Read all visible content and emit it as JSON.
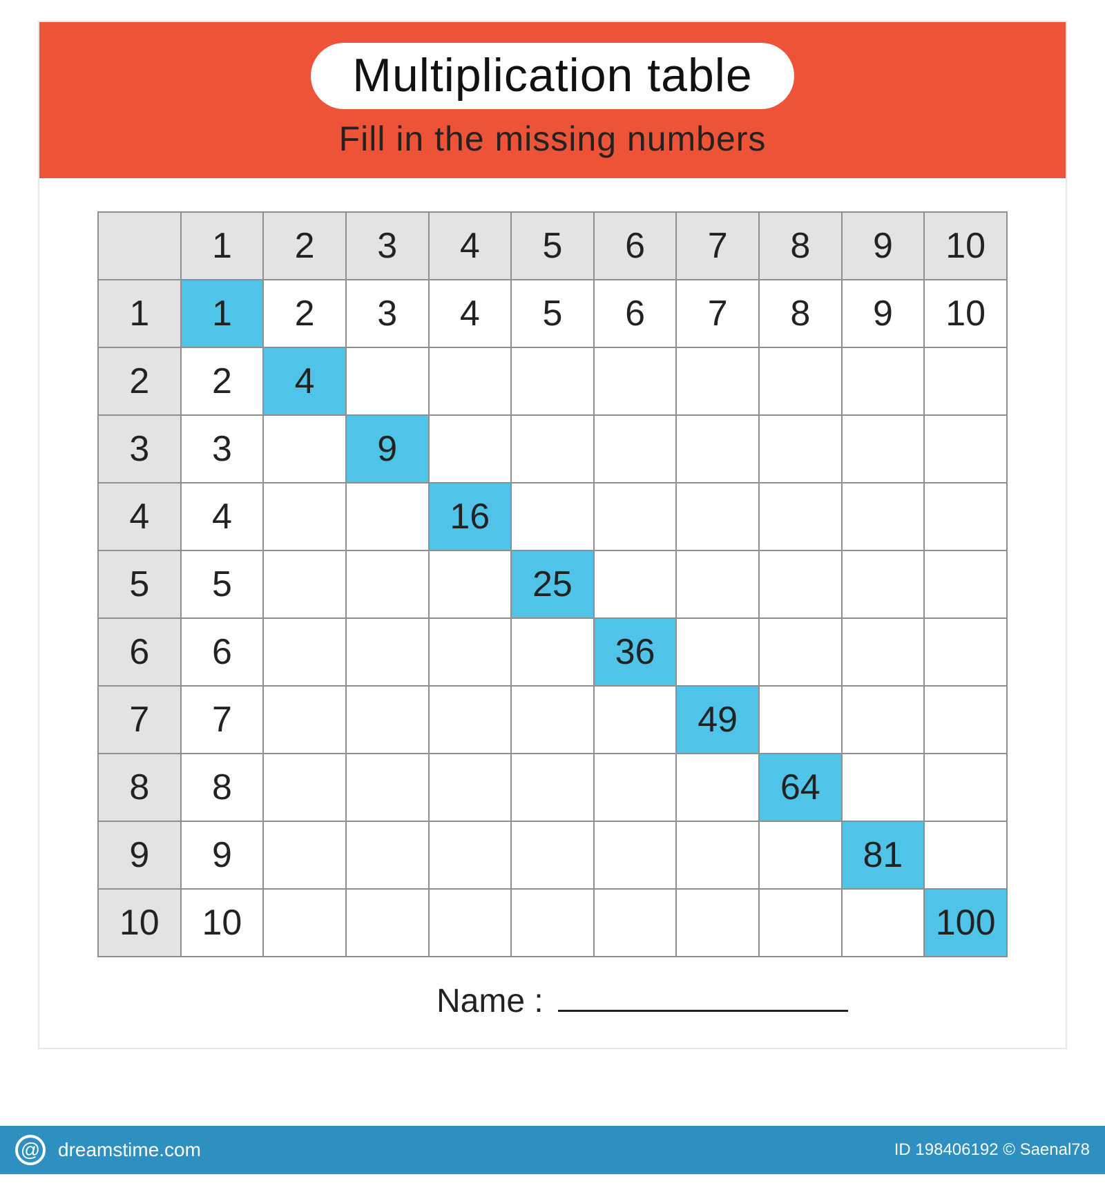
{
  "header": {
    "title": "Multiplication table",
    "subtitle": "Fill in the missing numbers"
  },
  "table": {
    "col_headers": [
      "1",
      "2",
      "3",
      "4",
      "5",
      "6",
      "7",
      "8",
      "9",
      "10"
    ],
    "rows": [
      {
        "header": "1",
        "cells": [
          "1",
          "2",
          "3",
          "4",
          "5",
          "6",
          "7",
          "8",
          "9",
          "10"
        ],
        "highlight_col": 0
      },
      {
        "header": "2",
        "cells": [
          "2",
          "4",
          "",
          "",
          "",
          "",
          "",
          "",
          "",
          ""
        ],
        "highlight_col": 1
      },
      {
        "header": "3",
        "cells": [
          "3",
          "",
          "9",
          "",
          "",
          "",
          "",
          "",
          "",
          ""
        ],
        "highlight_col": 2
      },
      {
        "header": "4",
        "cells": [
          "4",
          "",
          "",
          "16",
          "",
          "",
          "",
          "",
          "",
          ""
        ],
        "highlight_col": 3
      },
      {
        "header": "5",
        "cells": [
          "5",
          "",
          "",
          "",
          "25",
          "",
          "",
          "",
          "",
          ""
        ],
        "highlight_col": 4
      },
      {
        "header": "6",
        "cells": [
          "6",
          "",
          "",
          "",
          "",
          "36",
          "",
          "",
          "",
          ""
        ],
        "highlight_col": 5
      },
      {
        "header": "7",
        "cells": [
          "7",
          "",
          "",
          "",
          "",
          "",
          "49",
          "",
          "",
          ""
        ],
        "highlight_col": 6
      },
      {
        "header": "8",
        "cells": [
          "8",
          "",
          "",
          "",
          "",
          "",
          "",
          "64",
          "",
          ""
        ],
        "highlight_col": 7
      },
      {
        "header": "9",
        "cells": [
          "9",
          "",
          "",
          "",
          "",
          "",
          "",
          "",
          "81",
          ""
        ],
        "highlight_col": 8
      },
      {
        "header": "10",
        "cells": [
          "10",
          "",
          "",
          "",
          "",
          "",
          "",
          "",
          "",
          "100"
        ],
        "highlight_col": 9
      }
    ]
  },
  "name_label": "Name :",
  "footer": {
    "site": "dreamstime.com",
    "id_label": "ID 198406192 © Saenal78"
  },
  "colors": {
    "accent": "#ed5437",
    "highlight": "#4fc4e8",
    "header_cell": "#e3e3e3",
    "footer_bar": "#2e8fc1"
  }
}
